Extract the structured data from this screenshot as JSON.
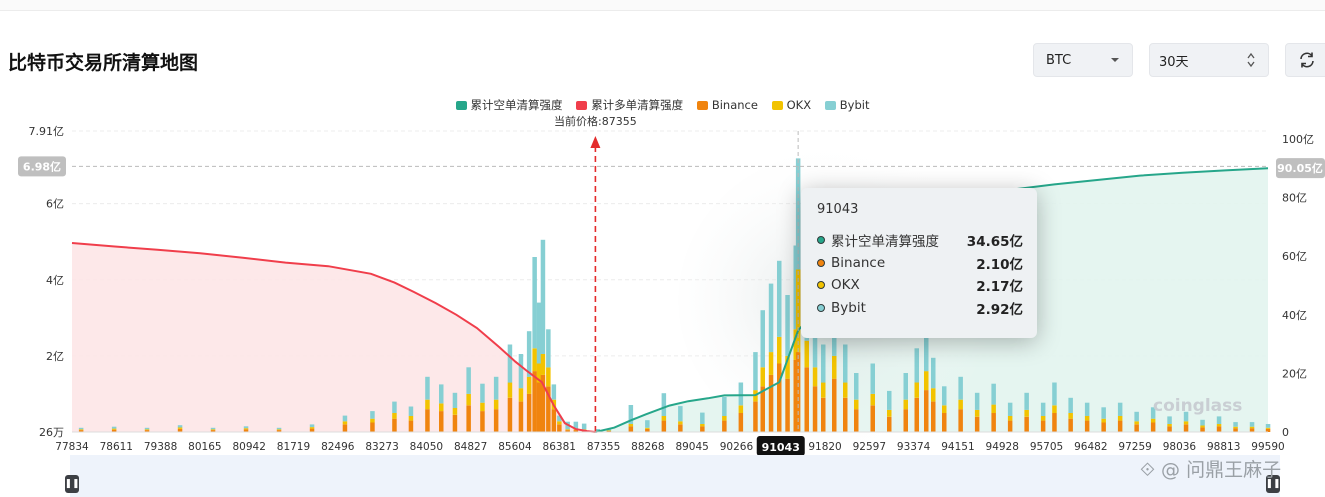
{
  "page": {
    "title": "比特币交易所清算地图"
  },
  "controls": {
    "coin": "BTC",
    "range": "30天"
  },
  "icons": {
    "caret": "caret-down-icon",
    "updown": "sort-updown-icon",
    "refresh": "refresh-icon",
    "handle": "pause-handle-icon"
  },
  "colors": {
    "short_cum": "#26a68a",
    "long_cum": "#f03e4b",
    "binance": "#f0840f",
    "okx": "#f2c300",
    "bybit": "#86cfd3"
  },
  "legend": [
    "累计空单清算强度",
    "累计多单清算强度",
    "Binance",
    "OKX",
    "Bybit"
  ],
  "brand": "coinglass",
  "watermark": "问鼎王麻子",
  "tooltip": {
    "title": "91043",
    "rows": [
      {
        "label": "累计空单清算强度",
        "value": "34.65亿"
      },
      {
        "label": "Binance",
        "value": "2.10亿"
      },
      {
        "label": "OKX",
        "value": "2.17亿"
      },
      {
        "label": "Bybit",
        "value": "2.92亿"
      }
    ]
  },
  "chart_data": {
    "type": "bar",
    "current_price_label": "当前价格:87355",
    "current_price": 87355,
    "highlight_category": "91043",
    "x_range": [
      77834,
      99590
    ],
    "x_ticks": [
      "77834",
      "78611",
      "79388",
      "80165",
      "80942",
      "81719",
      "82496",
      "83273",
      "84050",
      "84827",
      "85604",
      "86381",
      "87355",
      "88268",
      "89045",
      "90266",
      "91043",
      "91820",
      "92597",
      "93374",
      "94151",
      "94928",
      "95705",
      "96482",
      "97259",
      "98036",
      "98813",
      "99590"
    ],
    "y_left_ticks": [
      "26万",
      "2亿",
      "4亿",
      "6亿",
      "7.91亿"
    ],
    "y_left_tick_values": [
      0.0026,
      2,
      4,
      6,
      7.91
    ],
    "y_left_range": [
      0,
      7.91
    ],
    "y_left_unit": "亿",
    "y_left_crosshair": "6.98亿",
    "y_right_ticks": [
      "0",
      "20亿",
      "40亿",
      "60亿",
      "80亿",
      "100亿"
    ],
    "y_right_range": [
      0,
      100
    ],
    "y_right_unit": "亿",
    "y_right_crosshair": "90.05亿",
    "long_cumulative": {
      "name": "累计多单清算强度",
      "x": [
        77834,
        78611,
        79388,
        80165,
        80942,
        81719,
        82496,
        83273,
        83700,
        84050,
        84450,
        84827,
        85200,
        85604,
        85900,
        86100,
        86381,
        86600,
        86800,
        87000,
        87200,
        87355
      ],
      "y": [
        64.5,
        63.3,
        62.2,
        61.0,
        59.5,
        57.8,
        56.6,
        54.0,
        51.0,
        47.8,
        44.0,
        40.0,
        35.5,
        29.0,
        24.0,
        21.0,
        17.0,
        9.0,
        3.0,
        1.0,
        0.3,
        0
      ]
    },
    "short_cumulative": {
      "name": "累计空单清算强度",
      "x": [
        87355,
        87700,
        88000,
        88268,
        88700,
        89045,
        89400,
        89700,
        90266,
        90700,
        91043,
        91300,
        91820,
        92200,
        92597,
        93000,
        93374,
        94151,
        94928,
        95705,
        96482,
        97259,
        98036,
        98813,
        99590
      ],
      "y": [
        0,
        1.5,
        4.0,
        6.0,
        9.0,
        10.5,
        11.5,
        12.5,
        12.6,
        17.0,
        34.65,
        40.0,
        55.0,
        64.0,
        71.0,
        75.0,
        78.0,
        81.0,
        82.7,
        84.5,
        86.0,
        87.5,
        88.5,
        89.3,
        90.05
      ]
    },
    "series": [
      {
        "name": "Binance",
        "x": [
          78000,
          78600,
          79200,
          79800,
          80400,
          81000,
          81600,
          82200,
          82800,
          83300,
          83700,
          84000,
          84300,
          84550,
          84800,
          85050,
          85300,
          85550,
          85800,
          86000,
          86150,
          86250,
          86330,
          86400,
          86500,
          86600,
          86700,
          86850,
          87000,
          87150,
          87400,
          87600,
          88000,
          88300,
          88600,
          88900,
          89300,
          89700,
          90000,
          90266,
          90400,
          90550,
          90700,
          90850,
          91000,
          91043,
          91200,
          91350,
          91500,
          91700,
          91900,
          92100,
          92400,
          92700,
          93000,
          93200,
          93374,
          93500,
          93700,
          94000,
          94300,
          94600,
          94900,
          95200,
          95500,
          95705,
          96000,
          96300,
          96600,
          96900,
          97200,
          97500,
          97800,
          98100,
          98400,
          98700,
          99000,
          99300,
          99590
        ],
        "values": [
          0.05,
          0.06,
          0.05,
          0.08,
          0.05,
          0.07,
          0.05,
          0.09,
          0.2,
          0.25,
          0.35,
          0.3,
          0.6,
          0.55,
          0.45,
          0.7,
          0.55,
          0.6,
          0.9,
          0.8,
          1.0,
          1.6,
          1.3,
          1.5,
          1.2,
          0.6,
          0.2,
          0.05,
          0.05,
          0.05,
          0.02,
          0.03,
          0.15,
          0.08,
          0.3,
          0.2,
          0.15,
          0.3,
          0.5,
          0.8,
          1.2,
          1.5,
          1.8,
          1.4,
          1.9,
          2.1,
          1.7,
          1.2,
          0.9,
          1.4,
          0.9,
          0.6,
          0.7,
          0.4,
          0.6,
          0.9,
          1.1,
          0.8,
          0.5,
          0.6,
          0.4,
          0.5,
          0.3,
          0.4,
          0.3,
          0.5,
          0.35,
          0.3,
          0.25,
          0.3,
          0.2,
          0.25,
          0.15,
          0.2,
          0.12,
          0.15,
          0.1,
          0.1,
          0.08
        ]
      },
      {
        "name": "OKX",
        "x": [
          78000,
          78600,
          79200,
          79800,
          80400,
          81000,
          81600,
          82200,
          82800,
          83300,
          83700,
          84000,
          84300,
          84550,
          84800,
          85050,
          85300,
          85550,
          85800,
          86000,
          86150,
          86250,
          86330,
          86400,
          86500,
          86600,
          86700,
          86850,
          87000,
          87150,
          87400,
          87600,
          88000,
          88300,
          88600,
          88900,
          89300,
          89700,
          90000,
          90266,
          90400,
          90550,
          90700,
          90850,
          91000,
          91043,
          91200,
          91350,
          91500,
          91700,
          91900,
          92100,
          92400,
          92700,
          93000,
          93200,
          93374,
          93500,
          93700,
          94000,
          94300,
          94600,
          94900,
          95200,
          95500,
          95705,
          96000,
          96300,
          96600,
          96900,
          97200,
          97500,
          97800,
          98100,
          98400,
          98700,
          99000,
          99300,
          99590
        ],
        "values": [
          0.02,
          0.03,
          0.02,
          0.04,
          0.02,
          0.03,
          0.02,
          0.04,
          0.08,
          0.1,
          0.15,
          0.12,
          0.25,
          0.2,
          0.18,
          0.3,
          0.22,
          0.25,
          0.4,
          0.35,
          0.45,
          0.6,
          0.5,
          0.55,
          0.5,
          0.25,
          0.08,
          0.02,
          0.02,
          0.02,
          0.01,
          0.01,
          0.06,
          0.03,
          0.12,
          0.08,
          0.06,
          0.12,
          0.2,
          0.3,
          0.5,
          0.6,
          0.7,
          0.6,
          0.8,
          2.17,
          0.7,
          0.5,
          0.4,
          0.6,
          0.4,
          0.25,
          0.3,
          0.18,
          0.25,
          0.4,
          0.5,
          0.35,
          0.2,
          0.25,
          0.18,
          0.22,
          0.12,
          0.18,
          0.12,
          0.2,
          0.15,
          0.12,
          0.1,
          0.12,
          0.08,
          0.1,
          0.06,
          0.08,
          0.05,
          0.06,
          0.04,
          0.04,
          0.03
        ]
      },
      {
        "name": "Bybit",
        "x": [
          78000,
          78600,
          79200,
          79800,
          80400,
          81000,
          81600,
          82200,
          82800,
          83300,
          83700,
          84000,
          84300,
          84550,
          84800,
          85050,
          85300,
          85550,
          85800,
          86000,
          86150,
          86250,
          86330,
          86400,
          86500,
          86600,
          86700,
          86850,
          87000,
          87150,
          87400,
          87600,
          88000,
          88300,
          88600,
          88900,
          89300,
          89700,
          90000,
          90266,
          90400,
          90550,
          90700,
          90850,
          91000,
          91043,
          91200,
          91350,
          91500,
          91700,
          91900,
          92100,
          92400,
          92700,
          93000,
          93200,
          93374,
          93500,
          93700,
          94000,
          94300,
          94600,
          94900,
          95200,
          95500,
          95705,
          96000,
          96300,
          96600,
          96900,
          97200,
          97500,
          97800,
          98100,
          98400,
          98700,
          99000,
          99300,
          99590
        ],
        "values": [
          0.04,
          0.05,
          0.04,
          0.06,
          0.04,
          0.05,
          0.04,
          0.07,
          0.15,
          0.2,
          0.3,
          0.25,
          0.6,
          0.5,
          0.4,
          0.7,
          0.5,
          0.6,
          1.0,
          0.9,
          1.2,
          2.4,
          1.6,
          3.0,
          1.0,
          0.4,
          0.15,
          0.2,
          0.2,
          0.15,
          0.05,
          0.05,
          0.5,
          0.2,
          0.6,
          0.4,
          0.3,
          0.5,
          0.6,
          1.0,
          1.5,
          1.8,
          2.0,
          1.6,
          2.2,
          2.92,
          1.9,
          1.3,
          1.0,
          1.5,
          1.0,
          0.7,
          0.8,
          0.5,
          0.7,
          0.9,
          1.1,
          0.8,
          0.5,
          0.6,
          0.45,
          0.55,
          0.35,
          0.45,
          0.35,
          0.6,
          0.4,
          0.35,
          0.3,
          0.35,
          0.25,
          0.3,
          0.2,
          0.25,
          0.15,
          0.2,
          0.12,
          0.12,
          0.1
        ]
      }
    ]
  }
}
